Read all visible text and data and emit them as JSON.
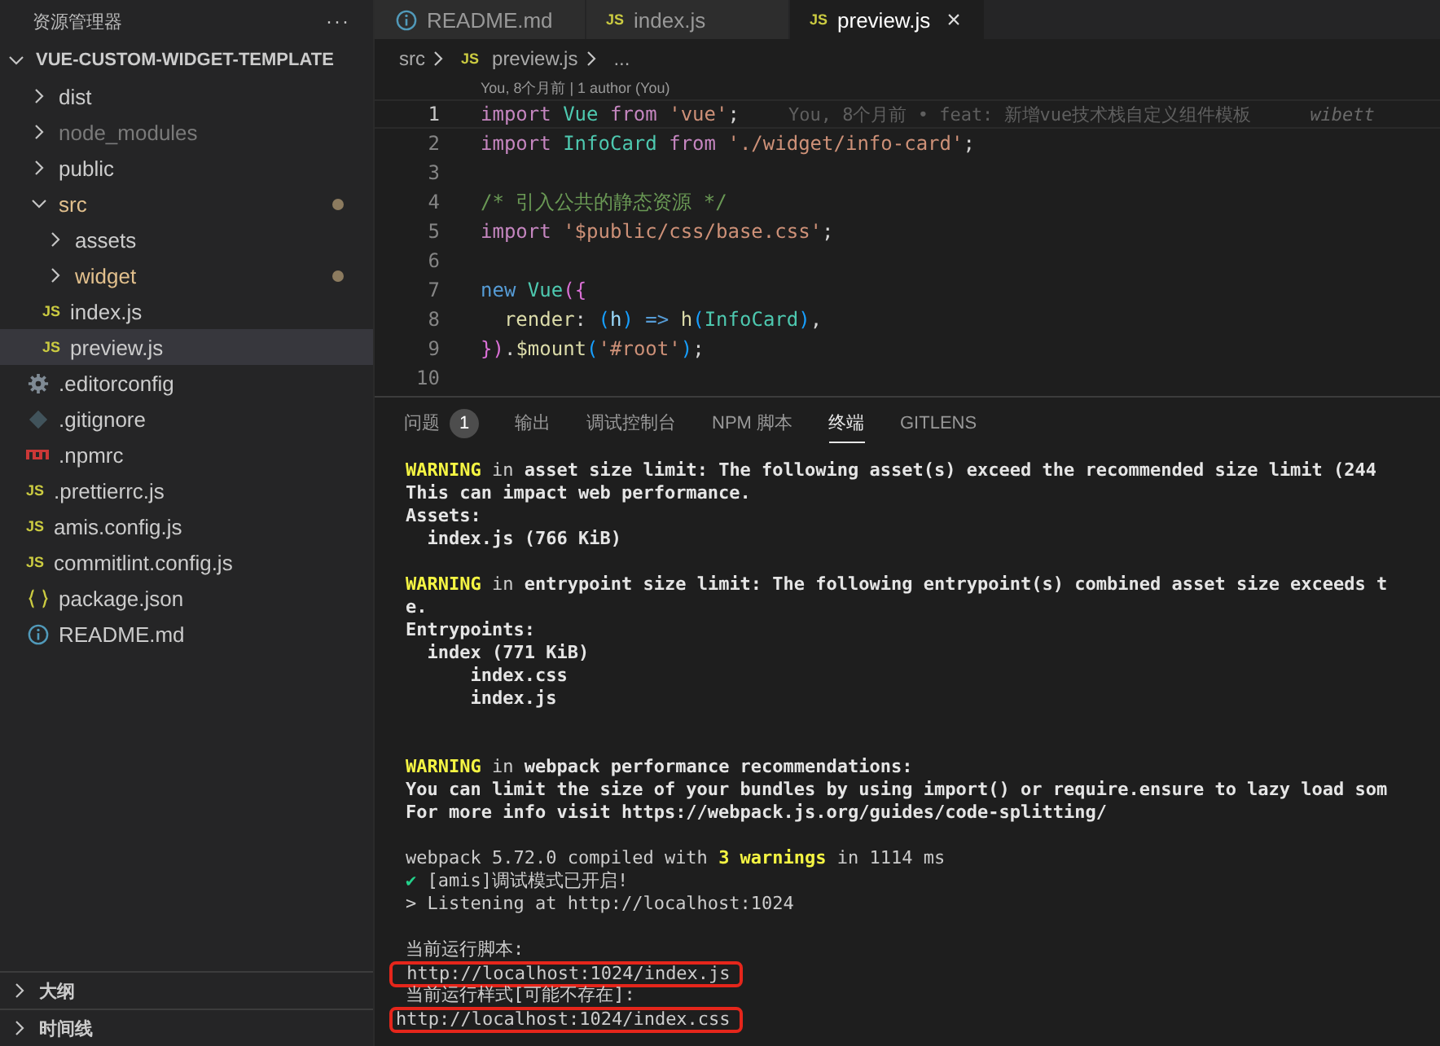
{
  "sidebar": {
    "title": "资源管理器",
    "more": "···",
    "project": {
      "label": "VUE-CUSTOM-WIDGET-TEMPLATE",
      "expanded": true
    },
    "tree": [
      {
        "label": "dist",
        "kind": "folder",
        "expanded": false,
        "dimmed": false,
        "modified": false,
        "selected": false
      },
      {
        "label": "node_modules",
        "kind": "folder",
        "expanded": false,
        "dimmed": true,
        "modified": false,
        "selected": false
      },
      {
        "label": "public",
        "kind": "folder",
        "expanded": false,
        "dimmed": false,
        "modified": false,
        "selected": false
      },
      {
        "label": "src",
        "kind": "folder",
        "expanded": true,
        "dimmed": false,
        "modified": true,
        "selected": false,
        "children": [
          {
            "label": "assets",
            "kind": "folder",
            "expanded": false,
            "dimmed": false,
            "modified": false,
            "selected": false
          },
          {
            "label": "widget",
            "kind": "folder",
            "expanded": false,
            "dimmed": false,
            "modified": true,
            "selected": false
          },
          {
            "label": "index.js",
            "kind": "js",
            "icon": "JS",
            "dimmed": false,
            "modified": false,
            "selected": false
          },
          {
            "label": "preview.js",
            "kind": "js",
            "icon": "JS",
            "dimmed": false,
            "modified": false,
            "selected": true
          }
        ]
      },
      {
        "label": ".editorconfig",
        "kind": "gear",
        "dimmed": false,
        "modified": false,
        "selected": false
      },
      {
        "label": ".gitignore",
        "kind": "git",
        "dimmed": false,
        "modified": false,
        "selected": false
      },
      {
        "label": ".npmrc",
        "kind": "npm",
        "dimmed": false,
        "modified": false,
        "selected": false
      },
      {
        "label": ".prettierrc.js",
        "kind": "js",
        "icon": "JS",
        "dimmed": false,
        "modified": false,
        "selected": false
      },
      {
        "label": "amis.config.js",
        "kind": "js",
        "icon": "JS",
        "dimmed": false,
        "modified": false,
        "selected": false
      },
      {
        "label": "commitlint.config.js",
        "kind": "js",
        "icon": "JS",
        "dimmed": false,
        "modified": false,
        "selected": false
      },
      {
        "label": "package.json",
        "kind": "json",
        "dimmed": false,
        "modified": false,
        "selected": false
      },
      {
        "label": "README.md",
        "kind": "info",
        "dimmed": false,
        "modified": false,
        "selected": false
      }
    ],
    "sections": [
      {
        "label": "大纲",
        "expanded": false
      },
      {
        "label": "时间线",
        "expanded": false
      }
    ]
  },
  "editor_tabs": [
    {
      "label": "README.md",
      "kind": "info",
      "selected": false
    },
    {
      "label": "index.js",
      "kind": "js",
      "icon": "JS",
      "selected": false
    },
    {
      "label": "preview.js",
      "kind": "js",
      "icon": "JS",
      "selected": true,
      "close": "×"
    }
  ],
  "breadcrumb": {
    "folder": "src",
    "file_icon": "JS",
    "file": "preview.js",
    "more": "..."
  },
  "codelens": "You, 8个月前 | 1 author (You)",
  "code_lines": [
    {
      "number": "1",
      "current": true,
      "tokens": [
        {
          "kind": "keyword",
          "text": "import "
        },
        {
          "kind": "class",
          "text": "Vue "
        },
        {
          "kind": "keyword",
          "text": "from "
        },
        {
          "kind": "string",
          "text": "'vue'"
        },
        {
          "kind": "plain",
          "text": ";"
        }
      ],
      "blame": "You, 8个月前 • feat: 新增vue技术栈自定义组件模板",
      "blame_author": "wibett"
    },
    {
      "number": "2",
      "current": false,
      "tokens": [
        {
          "kind": "keyword",
          "text": "import "
        },
        {
          "kind": "class",
          "text": "InfoCard "
        },
        {
          "kind": "keyword",
          "text": "from "
        },
        {
          "kind": "string",
          "text": "'./widget/info-card'"
        },
        {
          "kind": "plain",
          "text": ";"
        }
      ]
    },
    {
      "number": "3",
      "current": false
    },
    {
      "number": "4",
      "current": false,
      "tokens": [
        {
          "kind": "comment",
          "text": "/* 引入公共的静态资源 */"
        }
      ]
    },
    {
      "number": "5",
      "current": false,
      "tokens": [
        {
          "kind": "keyword",
          "text": "import "
        },
        {
          "kind": "string",
          "text": "'$public/css/base.css'"
        },
        {
          "kind": "plain",
          "text": ";"
        }
      ]
    },
    {
      "number": "6",
      "current": false
    },
    {
      "number": "7",
      "current": false,
      "tokens": [
        {
          "kind": "storage",
          "text": "new "
        },
        {
          "kind": "class",
          "text": "Vue"
        },
        {
          "kind": "bracket",
          "text": "({"
        }
      ]
    },
    {
      "number": "8",
      "current": false,
      "tokens": [
        {
          "kind": "func",
          "text": "  render"
        },
        {
          "kind": "plain",
          "text": ": "
        },
        {
          "kind": "paren",
          "text": "("
        },
        {
          "kind": "param",
          "text": "h"
        },
        {
          "kind": "paren",
          "text": ")"
        },
        {
          "kind": "storage",
          "text": " => "
        },
        {
          "kind": "func",
          "text": "h"
        },
        {
          "kind": "paren",
          "text": "("
        },
        {
          "kind": "class",
          "text": "InfoCard"
        },
        {
          "kind": "paren",
          "text": ")"
        },
        {
          "kind": "plain",
          "text": ","
        }
      ]
    },
    {
      "number": "9",
      "current": false,
      "tokens": [
        {
          "kind": "bracket",
          "text": "})"
        },
        {
          "kind": "plain",
          "text": "."
        },
        {
          "kind": "func",
          "text": "$mount"
        },
        {
          "kind": "paren",
          "text": "("
        },
        {
          "kind": "string",
          "text": "'#root'"
        },
        {
          "kind": "paren",
          "text": ")"
        },
        {
          "kind": "plain",
          "text": ";"
        }
      ]
    },
    {
      "number": "10",
      "current": false
    }
  ],
  "panel_tabs": [
    {
      "label": "问题",
      "badge": "1",
      "selected": false
    },
    {
      "label": "输出",
      "selected": false
    },
    {
      "label": "调试控制台",
      "selected": false
    },
    {
      "label": "NPM 脚本",
      "selected": false
    },
    {
      "label": "终端",
      "selected": true
    },
    {
      "label": "GITLENS",
      "selected": false
    }
  ],
  "terminal_blocks": [
    {
      "lines": [
        {
          "highlighted": false,
          "segments": [
            {
              "kind": "warning",
              "text": "WARNING"
            },
            {
              "kind": "normal",
              "text": " in "
            },
            {
              "kind": "bold",
              "text": "asset size limit: The following asset(s) exceed the recommended size limit (244"
            }
          ]
        },
        {
          "highlighted": false,
          "segments": [
            {
              "kind": "bold",
              "text": "This can impact web performance."
            }
          ]
        },
        {
          "highlighted": false,
          "segments": [
            {
              "kind": "bold",
              "text": "Assets:"
            }
          ]
        },
        {
          "highlighted": false,
          "segments": [
            {
              "kind": "bold",
              "text": "  index.js (766 KiB)"
            }
          ]
        }
      ]
    },
    {
      "lines": [
        {
          "highlighted": false,
          "segments": [
            {
              "kind": "warning",
              "text": "WARNING"
            },
            {
              "kind": "normal",
              "text": " in "
            },
            {
              "kind": "bold",
              "text": "entrypoint size limit: The following entrypoint(s) combined asset size exceeds t"
            }
          ]
        },
        {
          "highlighted": false,
          "segments": [
            {
              "kind": "bold",
              "text": "e."
            }
          ]
        },
        {
          "highlighted": false,
          "segments": [
            {
              "kind": "bold",
              "text": "Entrypoints:"
            }
          ]
        },
        {
          "highlighted": false,
          "segments": [
            {
              "kind": "bold",
              "text": "  index (771 KiB)"
            }
          ]
        },
        {
          "highlighted": false,
          "segments": [
            {
              "kind": "bold",
              "text": "      index.css"
            }
          ]
        },
        {
          "highlighted": false,
          "segments": [
            {
              "kind": "bold",
              "text": "      index.js"
            }
          ]
        }
      ]
    },
    {
      "lines": [
        {
          "highlighted": false,
          "segments": [
            {
              "kind": "warning",
              "text": "WARNING"
            },
            {
              "kind": "normal",
              "text": " in "
            },
            {
              "kind": "bold",
              "text": "webpack performance recommendations:"
            }
          ]
        },
        {
          "highlighted": false,
          "segments": [
            {
              "kind": "bold",
              "text": "You can limit the size of your bundles by using import() or require.ensure to lazy load som"
            }
          ]
        },
        {
          "highlighted": false,
          "segments": [
            {
              "kind": "bold",
              "text": "For more info visit https://webpack.js.org/guides/code-splitting/"
            }
          ]
        }
      ]
    },
    {
      "lines": [
        {
          "highlighted": false,
          "segments": [
            {
              "kind": "normal",
              "text": "webpack 5.72.0 compiled with "
            },
            {
              "kind": "warning",
              "text": "3 warnings"
            },
            {
              "kind": "normal",
              "text": " in 1114 ms"
            }
          ]
        },
        {
          "highlighted": false,
          "segments": [
            {
              "kind": "success",
              "text": "✔"
            },
            {
              "kind": "normal",
              "text": " [amis]调试模式已开启!"
            }
          ]
        },
        {
          "highlighted": false,
          "segments": [
            {
              "kind": "normal",
              "text": "> Listening at http://localhost:1024"
            }
          ]
        }
      ]
    },
    {
      "lines": [
        {
          "highlighted": false,
          "segments": [
            {
              "kind": "normal",
              "text": "当前运行脚本:"
            }
          ]
        },
        {
          "highlighted": true,
          "segments": [
            {
              "kind": "normal",
              "text": " http://localhost:1024/index.js"
            }
          ]
        },
        {
          "highlighted": false,
          "segments": [
            {
              "kind": "normal",
              "text": "当前运行样式[可能不存在]:"
            }
          ]
        },
        {
          "highlighted": true,
          "segments": [
            {
              "kind": "normal",
              "text": "http://localhost:1024/index.css"
            }
          ]
        }
      ]
    }
  ]
}
